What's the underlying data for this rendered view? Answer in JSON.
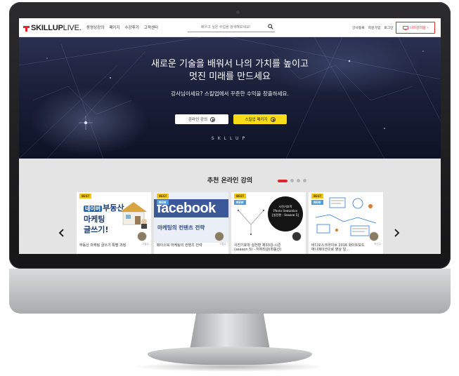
{
  "header": {
    "logo_text_a": "SKILLUP",
    "logo_text_b": "LIVE.",
    "nav": [
      "동영상강의",
      "패키지",
      "수강후기",
      "고객센터"
    ],
    "search_placeholder": "배우고 싶은 수업을 검색해보세요!",
    "utility": [
      "강사등록",
      "회원가입",
      "로그인"
    ],
    "mylecture_label": "나의강의실"
  },
  "hero": {
    "title_line1": "새로운 기술을 배워서 나의 가치를 높이고",
    "title_line2": "멋진 미래를 만드세요",
    "subtitle": "강사님이세요? 스킬업에서 꾸준한 수익을 창출하세요.",
    "btn_online": "온라인 강의",
    "btn_package": "스킬업 패키지",
    "brand": "SKLLUP"
  },
  "recommend": {
    "title": "추천 온라인 강의",
    "pager_count": 4,
    "pager_active": 0,
    "cards": [
      {
        "badges": [
          "BEST"
        ],
        "thumb_line1_tag": "부동산",
        "thumb_line1_prefix": "네이버",
        "thumb_line2": "마케팅",
        "thumb_line3": "글쓰기!",
        "title": "부동산 마케팅 글쓰기 특별 과정",
        "instructor": "고철수"
      },
      {
        "badges": [
          "BEST",
          "NEW"
        ],
        "thumb_brand": "facebook",
        "thumb_sub": "마케팅의 컨텐츠 전략",
        "title": "페이스북 마케팅의 컨텐츠 전략",
        "instructor": "고철수"
      },
      {
        "badges": [
          "BEST",
          "NEW"
        ],
        "thumb_line1": "사진기호학",
        "thumb_line2": "Photo Semiotics",
        "thumb_line3": "[실전편 - Season 5]",
        "title": "사진기호학 실전편 제33강-시즌(season 5) - 저자직강(최동산)",
        "instructor": ""
      },
      {
        "badges": [
          "BEST",
          "NEW"
        ],
        "title": "비디오스크라이브 2016 화이트보드 애니메이션으로 영상 일...",
        "instructor": "박민수"
      }
    ]
  },
  "colors": {
    "brand_red": "#e0262d",
    "accent_yellow": "#f8dc1a",
    "facebook_blue": "#3b5998"
  }
}
